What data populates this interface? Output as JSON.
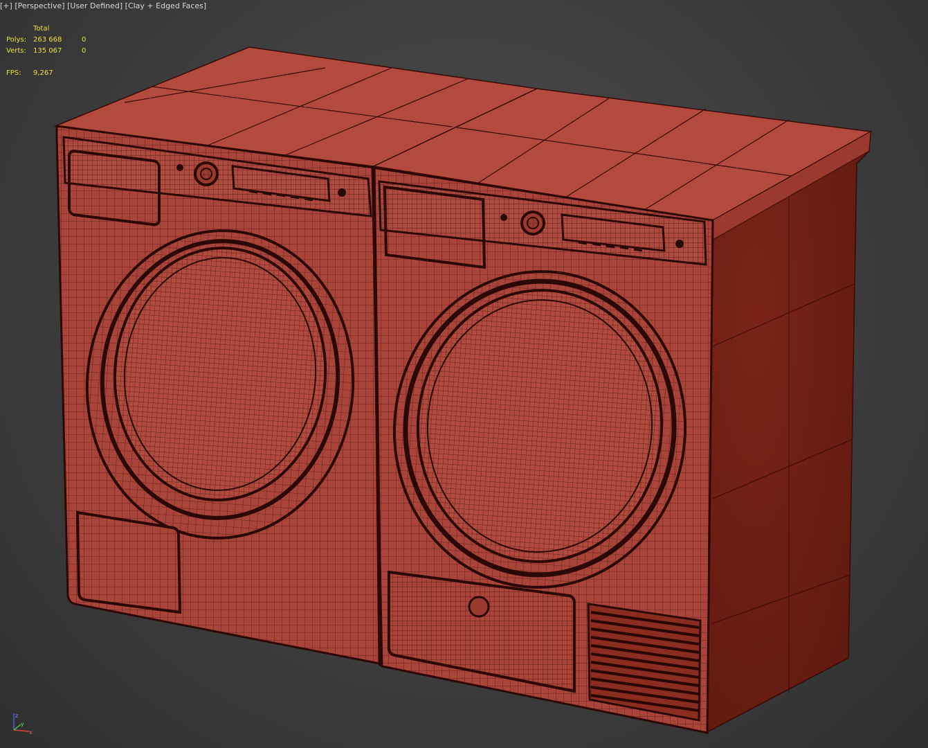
{
  "viewport": {
    "label_parts": [
      "[+]",
      "[Perspective]",
      "[User Defined]",
      "[Clay + Edged Faces]"
    ]
  },
  "stats": {
    "header": "Total",
    "rows": [
      {
        "label": "Polys:",
        "total": "263 668",
        "selected": "0"
      },
      {
        "label": "Verts:",
        "total": "135 067",
        "selected": "0"
      }
    ],
    "fps_label": "FPS:",
    "fps_value": "9,267"
  },
  "axis_gizmo": {
    "labels": [
      "z",
      "y",
      "x"
    ],
    "colors": {
      "x": "#e04040",
      "y": "#40c040",
      "z": "#4060e0"
    }
  },
  "model": {
    "name": "washer-dryer",
    "clay_color": "#b0473c",
    "side_color": "#6e1f15",
    "wire_color": "#3a0a06"
  }
}
